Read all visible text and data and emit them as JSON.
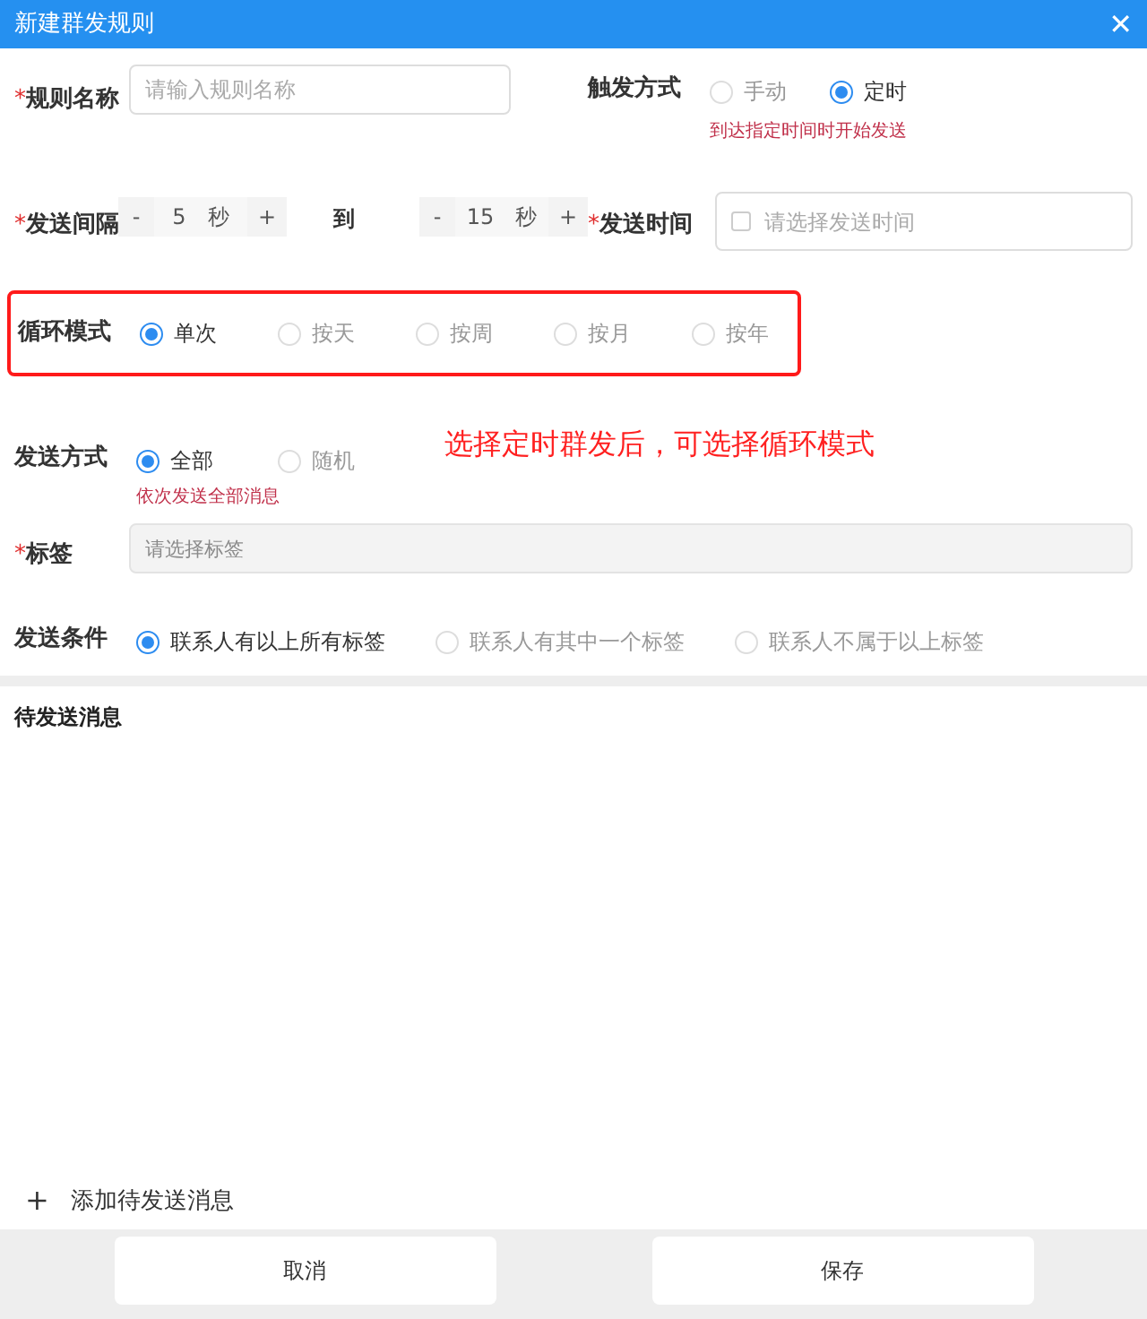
{
  "window": {
    "title": "新建群发规则",
    "close": "✕"
  },
  "rule_name": {
    "mark": "*",
    "label": "规则名称",
    "placeholder": "请输入规则名称"
  },
  "trigger": {
    "label": "触发方式",
    "options": [
      {
        "label": "手动",
        "selected": false
      },
      {
        "label": "定时",
        "selected": true
      }
    ],
    "hint": "到达指定时间时开始发送"
  },
  "interval": {
    "mark": "*",
    "label": "发送间隔",
    "from": {
      "minus": "-",
      "value": "5",
      "unit": "秒",
      "plus": "+"
    },
    "to_label": "到",
    "to": {
      "minus": "-",
      "value": "15",
      "unit": "秒",
      "plus": "+"
    }
  },
  "send_time": {
    "mark": "*",
    "label": "发送时间",
    "placeholder": "请选择发送时间"
  },
  "loop_mode": {
    "label": "循环模式",
    "highlighted": true,
    "options": [
      {
        "label": "单次",
        "selected": true
      },
      {
        "label": "按天",
        "selected": false
      },
      {
        "label": "按周",
        "selected": false
      },
      {
        "label": "按月",
        "selected": false
      },
      {
        "label": "按年",
        "selected": false
      }
    ]
  },
  "send_mode": {
    "label": "发送方式",
    "options": [
      {
        "label": "全部",
        "selected": true
      },
      {
        "label": "随机",
        "selected": false
      }
    ],
    "hint": "依次发送全部消息"
  },
  "annotation": "选择定时群发后，可选择循环模式",
  "tags": {
    "mark": "*",
    "label": "标签",
    "placeholder": "请选择标签"
  },
  "conditions": {
    "label": "发送条件",
    "options": [
      {
        "label": "联系人有以上所有标签",
        "selected": true
      },
      {
        "label": "联系人有其中一个标签",
        "selected": false
      },
      {
        "label": "联系人不属于以上标签",
        "selected": false
      }
    ]
  },
  "pending": {
    "title": "待发送消息",
    "add_icon": "+",
    "add_label": "添加待发送消息"
  },
  "buttons": [
    "取消",
    "保存"
  ]
}
